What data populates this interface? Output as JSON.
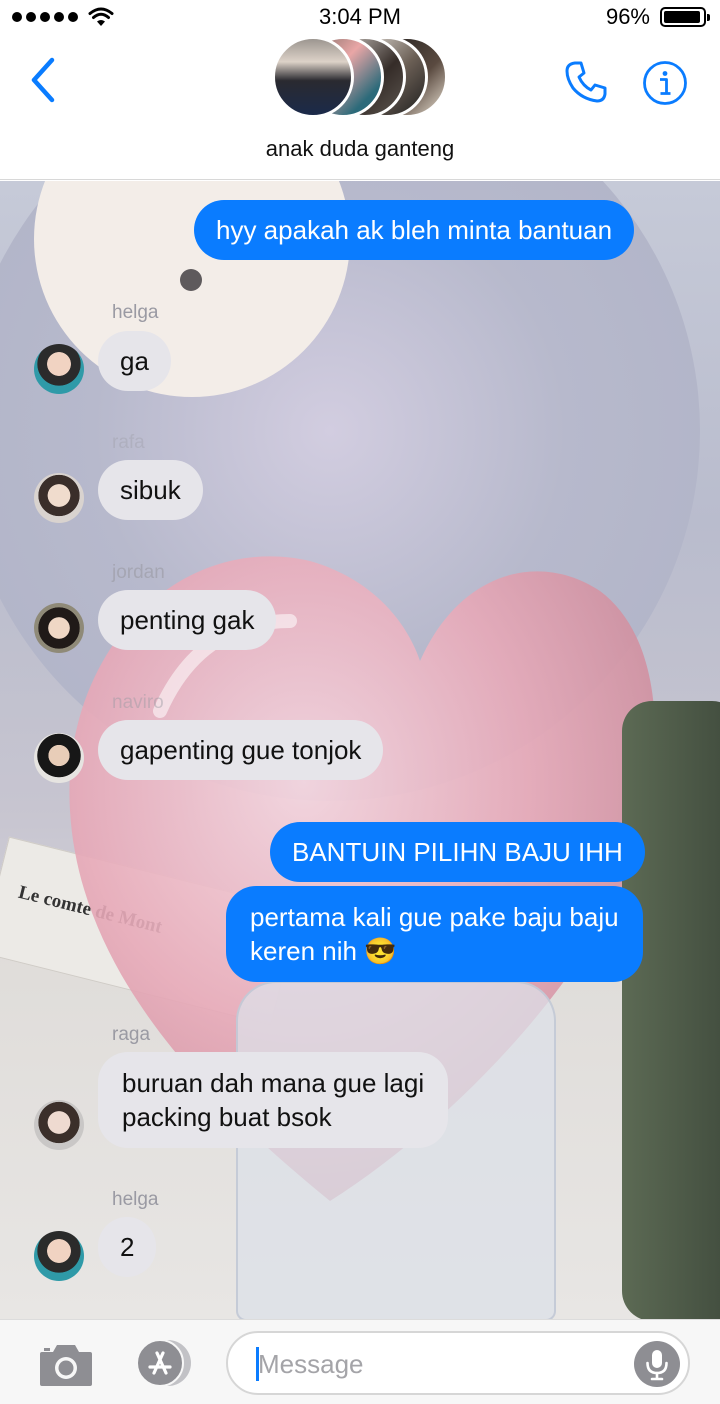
{
  "status_bar": {
    "time": "3:04 PM",
    "battery_percent": "96%",
    "signal_bars": 5,
    "battery_level": 0.96
  },
  "header": {
    "group_name": "anak duda ganteng",
    "accent_color": "#0a7cff"
  },
  "messages": [
    {
      "direction": "out",
      "text": "hyy apakah ak bleh minta bantuan"
    },
    {
      "direction": "in",
      "sender": "helga",
      "text": "ga"
    },
    {
      "direction": "in",
      "sender": "rafa",
      "text": "sibuk"
    },
    {
      "direction": "in",
      "sender": "jordan",
      "text": "penting gak"
    },
    {
      "direction": "in",
      "sender": "naviro",
      "text": "gapenting gue tonjok"
    },
    {
      "direction": "out",
      "text": "BANTUIN PILIHN BAJU IHH"
    },
    {
      "direction": "out",
      "text_lines": [
        "pertama kali gue pake baju baju",
        "keren nih 😎"
      ]
    },
    {
      "direction": "in",
      "sender": "raga",
      "text_lines": [
        "buruan dah mana gue lagi",
        "packing buat bsok"
      ]
    },
    {
      "direction": "in",
      "sender": "helga",
      "text": "2"
    }
  ],
  "background": {
    "book_title": "Le comte de Mont"
  },
  "input": {
    "placeholder": "Message",
    "value": ""
  },
  "icons": {
    "back": "chevron-left-icon",
    "call": "phone-icon",
    "info": "info-icon",
    "camera": "camera-icon",
    "apps": "app-store-icon",
    "mic": "microphone-icon"
  },
  "colors": {
    "outgoing_bubble": "#0a7cff",
    "incoming_bubble": "#e6e5ea",
    "sender_label": "#9a9aa3"
  }
}
